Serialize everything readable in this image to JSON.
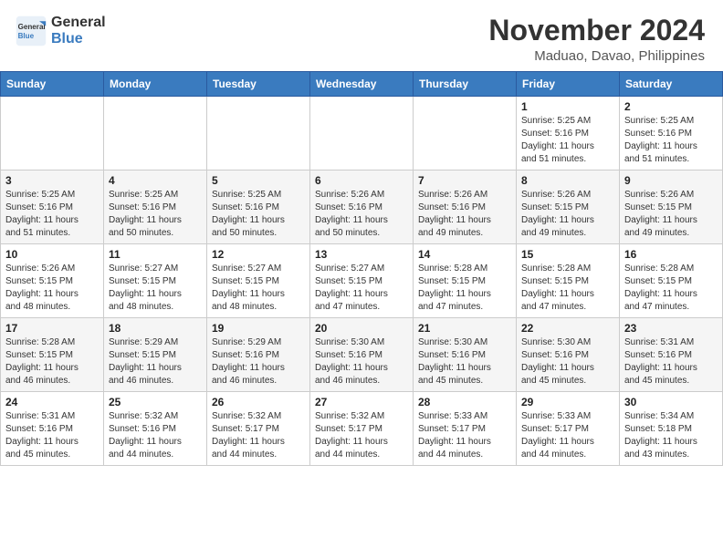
{
  "header": {
    "logo_line1": "General",
    "logo_line2": "Blue",
    "month": "November 2024",
    "location": "Maduao, Davao, Philippines"
  },
  "days_of_week": [
    "Sunday",
    "Monday",
    "Tuesday",
    "Wednesday",
    "Thursday",
    "Friday",
    "Saturday"
  ],
  "weeks": [
    {
      "days": [
        {
          "num": "",
          "info": ""
        },
        {
          "num": "",
          "info": ""
        },
        {
          "num": "",
          "info": ""
        },
        {
          "num": "",
          "info": ""
        },
        {
          "num": "",
          "info": ""
        },
        {
          "num": "1",
          "info": "Sunrise: 5:25 AM\nSunset: 5:16 PM\nDaylight: 11 hours\nand 51 minutes."
        },
        {
          "num": "2",
          "info": "Sunrise: 5:25 AM\nSunset: 5:16 PM\nDaylight: 11 hours\nand 51 minutes."
        }
      ]
    },
    {
      "days": [
        {
          "num": "3",
          "info": "Sunrise: 5:25 AM\nSunset: 5:16 PM\nDaylight: 11 hours\nand 51 minutes."
        },
        {
          "num": "4",
          "info": "Sunrise: 5:25 AM\nSunset: 5:16 PM\nDaylight: 11 hours\nand 50 minutes."
        },
        {
          "num": "5",
          "info": "Sunrise: 5:25 AM\nSunset: 5:16 PM\nDaylight: 11 hours\nand 50 minutes."
        },
        {
          "num": "6",
          "info": "Sunrise: 5:26 AM\nSunset: 5:16 PM\nDaylight: 11 hours\nand 50 minutes."
        },
        {
          "num": "7",
          "info": "Sunrise: 5:26 AM\nSunset: 5:16 PM\nDaylight: 11 hours\nand 49 minutes."
        },
        {
          "num": "8",
          "info": "Sunrise: 5:26 AM\nSunset: 5:15 PM\nDaylight: 11 hours\nand 49 minutes."
        },
        {
          "num": "9",
          "info": "Sunrise: 5:26 AM\nSunset: 5:15 PM\nDaylight: 11 hours\nand 49 minutes."
        }
      ]
    },
    {
      "days": [
        {
          "num": "10",
          "info": "Sunrise: 5:26 AM\nSunset: 5:15 PM\nDaylight: 11 hours\nand 48 minutes."
        },
        {
          "num": "11",
          "info": "Sunrise: 5:27 AM\nSunset: 5:15 PM\nDaylight: 11 hours\nand 48 minutes."
        },
        {
          "num": "12",
          "info": "Sunrise: 5:27 AM\nSunset: 5:15 PM\nDaylight: 11 hours\nand 48 minutes."
        },
        {
          "num": "13",
          "info": "Sunrise: 5:27 AM\nSunset: 5:15 PM\nDaylight: 11 hours\nand 47 minutes."
        },
        {
          "num": "14",
          "info": "Sunrise: 5:28 AM\nSunset: 5:15 PM\nDaylight: 11 hours\nand 47 minutes."
        },
        {
          "num": "15",
          "info": "Sunrise: 5:28 AM\nSunset: 5:15 PM\nDaylight: 11 hours\nand 47 minutes."
        },
        {
          "num": "16",
          "info": "Sunrise: 5:28 AM\nSunset: 5:15 PM\nDaylight: 11 hours\nand 47 minutes."
        }
      ]
    },
    {
      "days": [
        {
          "num": "17",
          "info": "Sunrise: 5:28 AM\nSunset: 5:15 PM\nDaylight: 11 hours\nand 46 minutes."
        },
        {
          "num": "18",
          "info": "Sunrise: 5:29 AM\nSunset: 5:15 PM\nDaylight: 11 hours\nand 46 minutes."
        },
        {
          "num": "19",
          "info": "Sunrise: 5:29 AM\nSunset: 5:16 PM\nDaylight: 11 hours\nand 46 minutes."
        },
        {
          "num": "20",
          "info": "Sunrise: 5:30 AM\nSunset: 5:16 PM\nDaylight: 11 hours\nand 46 minutes."
        },
        {
          "num": "21",
          "info": "Sunrise: 5:30 AM\nSunset: 5:16 PM\nDaylight: 11 hours\nand 45 minutes."
        },
        {
          "num": "22",
          "info": "Sunrise: 5:30 AM\nSunset: 5:16 PM\nDaylight: 11 hours\nand 45 minutes."
        },
        {
          "num": "23",
          "info": "Sunrise: 5:31 AM\nSunset: 5:16 PM\nDaylight: 11 hours\nand 45 minutes."
        }
      ]
    },
    {
      "days": [
        {
          "num": "24",
          "info": "Sunrise: 5:31 AM\nSunset: 5:16 PM\nDaylight: 11 hours\nand 45 minutes."
        },
        {
          "num": "25",
          "info": "Sunrise: 5:32 AM\nSunset: 5:16 PM\nDaylight: 11 hours\nand 44 minutes."
        },
        {
          "num": "26",
          "info": "Sunrise: 5:32 AM\nSunset: 5:17 PM\nDaylight: 11 hours\nand 44 minutes."
        },
        {
          "num": "27",
          "info": "Sunrise: 5:32 AM\nSunset: 5:17 PM\nDaylight: 11 hours\nand 44 minutes."
        },
        {
          "num": "28",
          "info": "Sunrise: 5:33 AM\nSunset: 5:17 PM\nDaylight: 11 hours\nand 44 minutes."
        },
        {
          "num": "29",
          "info": "Sunrise: 5:33 AM\nSunset: 5:17 PM\nDaylight: 11 hours\nand 44 minutes."
        },
        {
          "num": "30",
          "info": "Sunrise: 5:34 AM\nSunset: 5:18 PM\nDaylight: 11 hours\nand 43 minutes."
        }
      ]
    }
  ]
}
